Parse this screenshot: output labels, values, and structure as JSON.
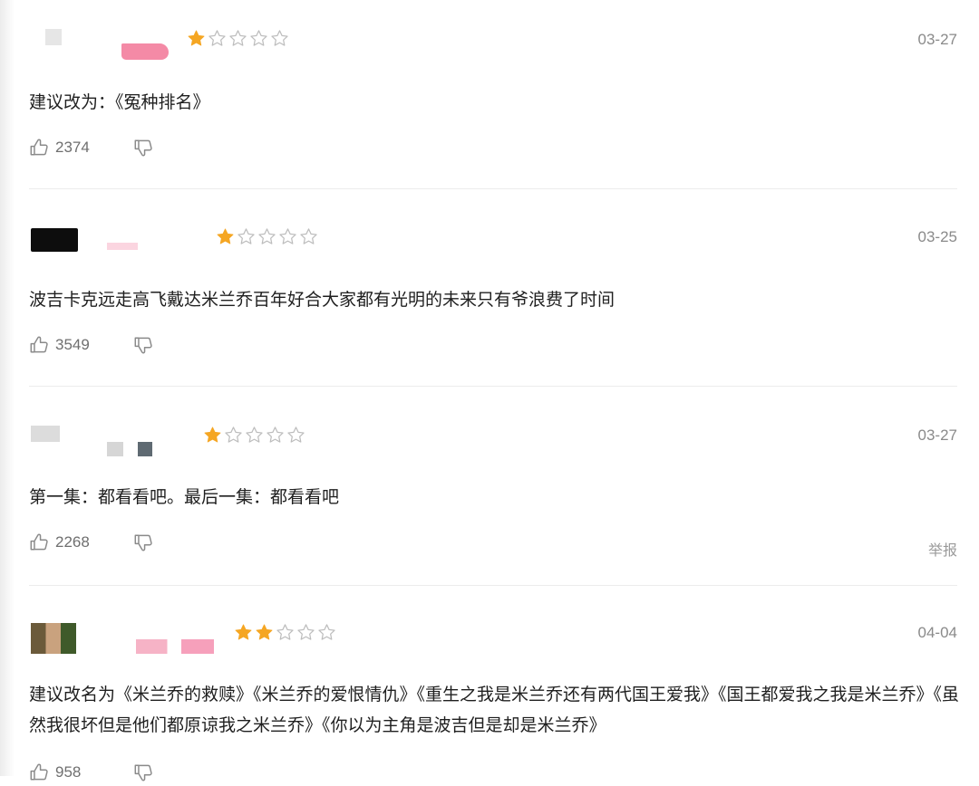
{
  "reviews": [
    {
      "stars": 1,
      "date": "03-27",
      "text": "建议改为：《冤种排名》",
      "likes": "2374",
      "report": ""
    },
    {
      "stars": 1,
      "date": "03-25",
      "text": "波吉卡克远走高飞戴达米兰乔百年好合大家都有光明的未来只有爷浪费了时间",
      "likes": "3549",
      "report": ""
    },
    {
      "stars": 1,
      "date": "03-27",
      "text": "第一集：都看看吧。最后一集：都看看吧",
      "likes": "2268",
      "report": "举报"
    },
    {
      "stars": 2,
      "date": "04-04",
      "text": "建议改名为《米兰乔的救赎》《米兰乔的爱恨情仇》《重生之我是米兰乔还有两代国王爱我》《国王都爱我之我是米兰乔》《虽然我很坏但是他们都原谅我之米兰乔》《你以为主角是波吉但是却是米兰乔》",
      "likes": "958",
      "report": ""
    }
  ],
  "colors": {
    "star_filled": "#f5a623",
    "star_empty_stroke": "#bdbdbd",
    "date": "#8a8a8a",
    "count": "#6f6f6f"
  },
  "icons": {
    "like": "thumbs-up-icon",
    "dislike": "thumbs-down-icon",
    "star": "star-icon"
  }
}
